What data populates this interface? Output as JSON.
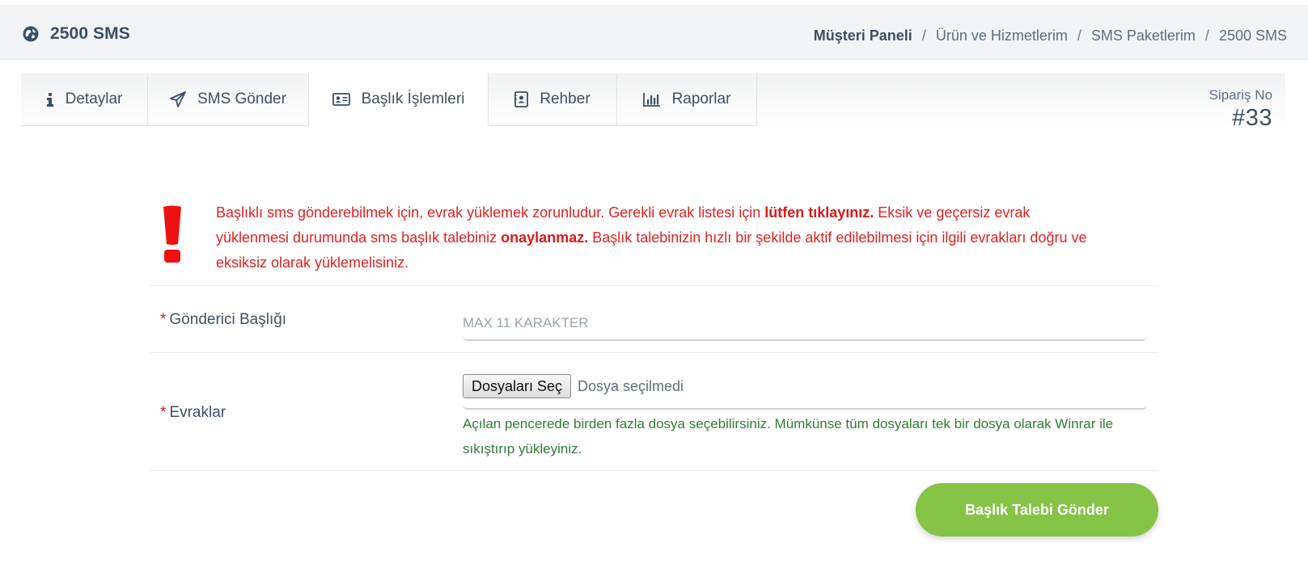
{
  "header": {
    "title": "2500 SMS",
    "breadcrumb": [
      "Müşteri Paneli",
      "Ürün ve Hizmetlerim",
      "SMS Paketlerim",
      "2500 SMS"
    ],
    "separator": "/"
  },
  "tabs": [
    {
      "label": "Detaylar",
      "icon": "info-icon"
    },
    {
      "label": "SMS Gönder",
      "icon": "paper-plane-icon"
    },
    {
      "label": "Başlık İşlemleri",
      "icon": "id-card-icon",
      "active": true
    },
    {
      "label": "Rehber",
      "icon": "contact-book-icon"
    },
    {
      "label": "Raporlar",
      "icon": "bar-chart-icon"
    }
  ],
  "order": {
    "label": "Sipariş No",
    "number": "#33"
  },
  "alert": {
    "part1": "Başlıklı sms gönderebilmek için, evrak yüklemek zorunludur. Gerekli evrak listesi için ",
    "link": "lütfen tıklayınız.",
    "part2": " Eksik ve geçersiz evrak yüklenmesi durumunda sms başlık talebiniz ",
    "bold": "onaylanmaz.",
    "part3": " Başlık talebinizin hızlı bir şekilde aktif edilebilmesi için ilgili evrakları doğru ve eksiksiz olarak yüklemelisiniz."
  },
  "form": {
    "required_mark": "*",
    "sender_label": "Gönderici Başlığı",
    "sender_placeholder": "MAX 11 KARAKTER",
    "sender_value": "",
    "docs_label": "Evraklar",
    "file_button": "Dosyaları Seç",
    "file_status": "Dosya seçilmedi",
    "hint": "Açılan pencerede birden fazla dosya seçebilirsiniz. Mümkünse tüm dosyaları tek bir dosya olarak Winrar ile sıkıştırıp yükleyiniz.",
    "submit": "Başlık Talebi Gönder"
  },
  "colors": {
    "alert": "#e02222",
    "hint": "#2f7d32",
    "submit": "#85c446",
    "text": "#3d4f63"
  }
}
